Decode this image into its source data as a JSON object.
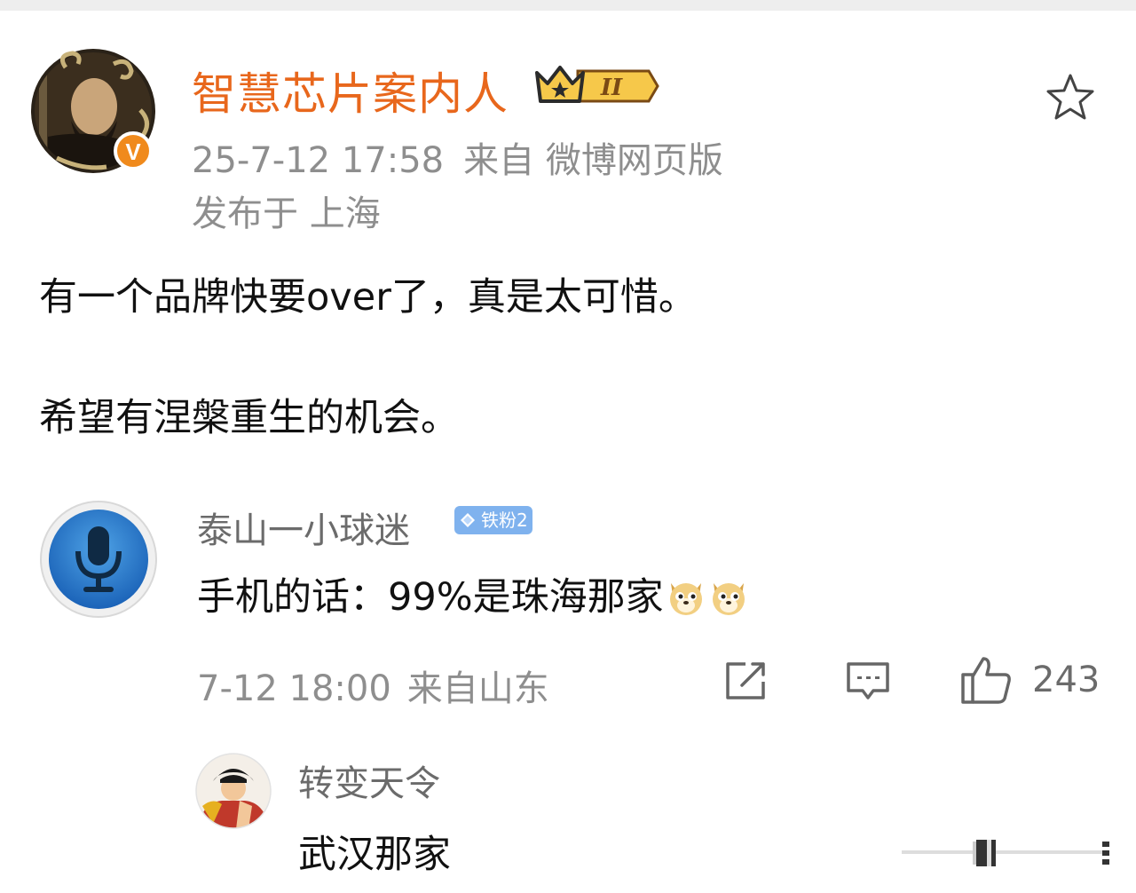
{
  "post": {
    "author": "智慧芯片案内人",
    "level_badge": "II",
    "time": "25-7-12 17:58",
    "source": "来自 微博网页版",
    "location": "发布于 上海",
    "line1": "有一个品牌快要over了，真是太可惜。",
    "line2": "希望有涅槃重生的机会。",
    "verified_mark": "V"
  },
  "comment": {
    "user": "泰山一小球迷",
    "fan_badge": "铁粉2",
    "text": "手机的话：99%是珠海那家",
    "time": "7-12 18:00",
    "source": "来自山东",
    "likes": "243"
  },
  "reply": {
    "user": "转变天令",
    "text": "武汉那家"
  },
  "colors": {
    "author": "#e8671c",
    "meta": "#8e8e8e",
    "badge": "#7fb2ee",
    "verified": "#f08a1c"
  },
  "icons": {
    "favorite": "star-outline-icon",
    "share": "share-icon",
    "comment": "comment-icon",
    "like": "thumbs-up-icon",
    "emoji": "doge-emoji-icon"
  }
}
